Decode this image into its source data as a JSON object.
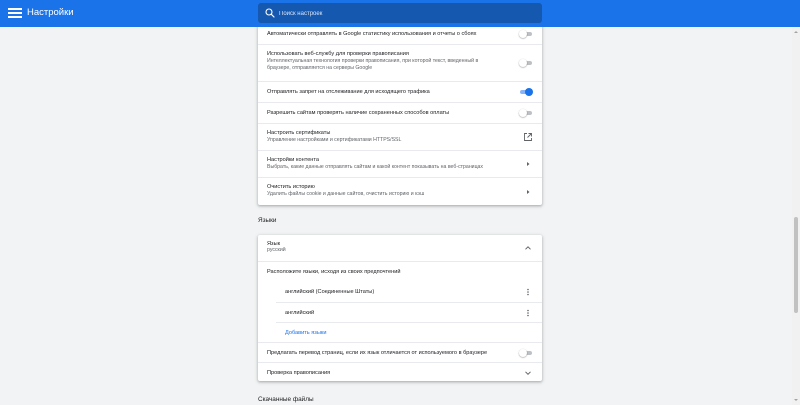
{
  "header": {
    "title": "Настройки",
    "search_placeholder": "Поиск настроек"
  },
  "privacy": {
    "items": [
      {
        "label": "Автоматически отправлять в Google статистику использования и отчеты о сбоях",
        "toggle": false
      },
      {
        "label": "Использовать веб-службу для проверки правописания",
        "desc": "Интеллектуальная технология проверки правописания, при которой текст, введенный в браузере, отправляется на серверы Google",
        "toggle": false
      },
      {
        "label": "Отправлять запрет на отслеживание для исходящего трафика",
        "toggle": true
      },
      {
        "label": "Разрешить сайтам проверять наличие сохраненных способов оплаты",
        "toggle": false
      },
      {
        "label": "Настроить сертификаты",
        "desc": "Управление настройками и сертификатами HTTPS/SSL",
        "icon": "external-link-icon"
      },
      {
        "label": "Настройки контента",
        "desc": "Выбрать, какие данные отправлять сайтам и какой контент показывать на веб-страницах",
        "icon": "chevron-right-icon"
      },
      {
        "label": "Очистить историю",
        "desc": "Удалить файлы cookie и данные сайтов, очистить историю и кэш",
        "icon": "chevron-right-icon"
      }
    ]
  },
  "languages": {
    "section_title": "Языки",
    "language_label": "Язык",
    "language_value": "русский",
    "order_label": "Расположите языки, исходя из своих предпочтений",
    "list": [
      {
        "name": "английский (Соединенные Штаты)"
      },
      {
        "name": "английский"
      }
    ],
    "add_label": "Добавить языки",
    "translate_label": "Предлагать перевод страниц, если их язык отличается от используемого в браузере",
    "translate_toggle": false,
    "spellcheck_label": "Проверка правописания"
  },
  "downloads": {
    "section_title": "Скачанные файлы"
  },
  "colors": {
    "accent": "#1a73e8",
    "background": "#f1f3f4"
  }
}
